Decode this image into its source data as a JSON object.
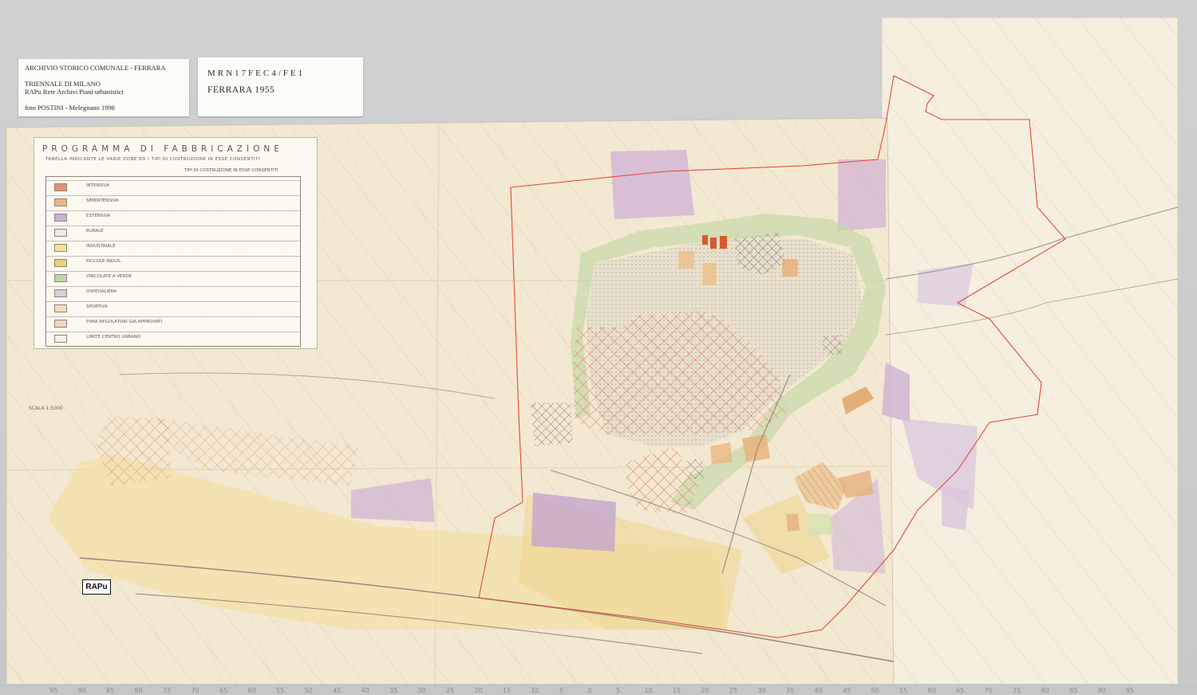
{
  "archive_card": {
    "line1": "ARCHIVIO STORICO COMUNALE - FERRARA",
    "line2": "TRIENNALE DI MILANO",
    "line3": "RAPu Rete Archivi Piani urbanistici",
    "line4": "foto POSTINI - Melegnano 1998"
  },
  "id_card": {
    "code": "MRN17FEC4/FE1",
    "title": "FERRARA 1955"
  },
  "map": {
    "legend_title": "PROGRAMMA DI FABBRICAZIONE",
    "legend_subtitle": "TABELLA INDICANTE LE VARIE ZONE ED I TIPI DI COSTRUZIONE IN ESSE CONSENTITI",
    "legend_header": "TIPI DI COSTRUZIONE IN ESSE CONSENTITI",
    "legend_rows": [
      {
        "name": "INTENSIVA",
        "color": "#e98e74"
      },
      {
        "name": "SEMINTENSIVA",
        "color": "#eab67e"
      },
      {
        "name": "ESTENSIVA",
        "color": "#cdb0d2"
      },
      {
        "name": "RURALE",
        "color": "#f1ecd9"
      },
      {
        "name": "INDUSTRIALE",
        "color": "#f2e09e"
      },
      {
        "name": "PICCOLE INDUS.",
        "color": "#f0d07a"
      },
      {
        "name": "VINCOLATE A VERDE",
        "color": "#bfd6a6"
      },
      {
        "name": "OSPEDALIERA",
        "color": "#d7cfd9"
      },
      {
        "name": "SPORTIVA",
        "color": "#f2e1b6"
      },
      {
        "name": "PIANI REGOLATORI GIA APPROVATI",
        "color": "#f6d3c4"
      },
      {
        "name": "LIMITE CENTRO URBANO",
        "color": "#f6eee2"
      }
    ],
    "scale": "SCALA 1:5000",
    "rapu_logo": "RAPu"
  },
  "ruler": {
    "labels": [
      "95",
      "90",
      "85",
      "80",
      "75",
      "70",
      "65",
      "60",
      "55",
      "50",
      "45",
      "40",
      "35",
      "30",
      "25",
      "20",
      "15",
      "10",
      "5",
      "0",
      "5",
      "10",
      "15",
      "20",
      "25",
      "30",
      "35",
      "40",
      "45",
      "50",
      "55",
      "60",
      "65",
      "70",
      "75",
      "80",
      "85",
      "90",
      "95"
    ]
  }
}
